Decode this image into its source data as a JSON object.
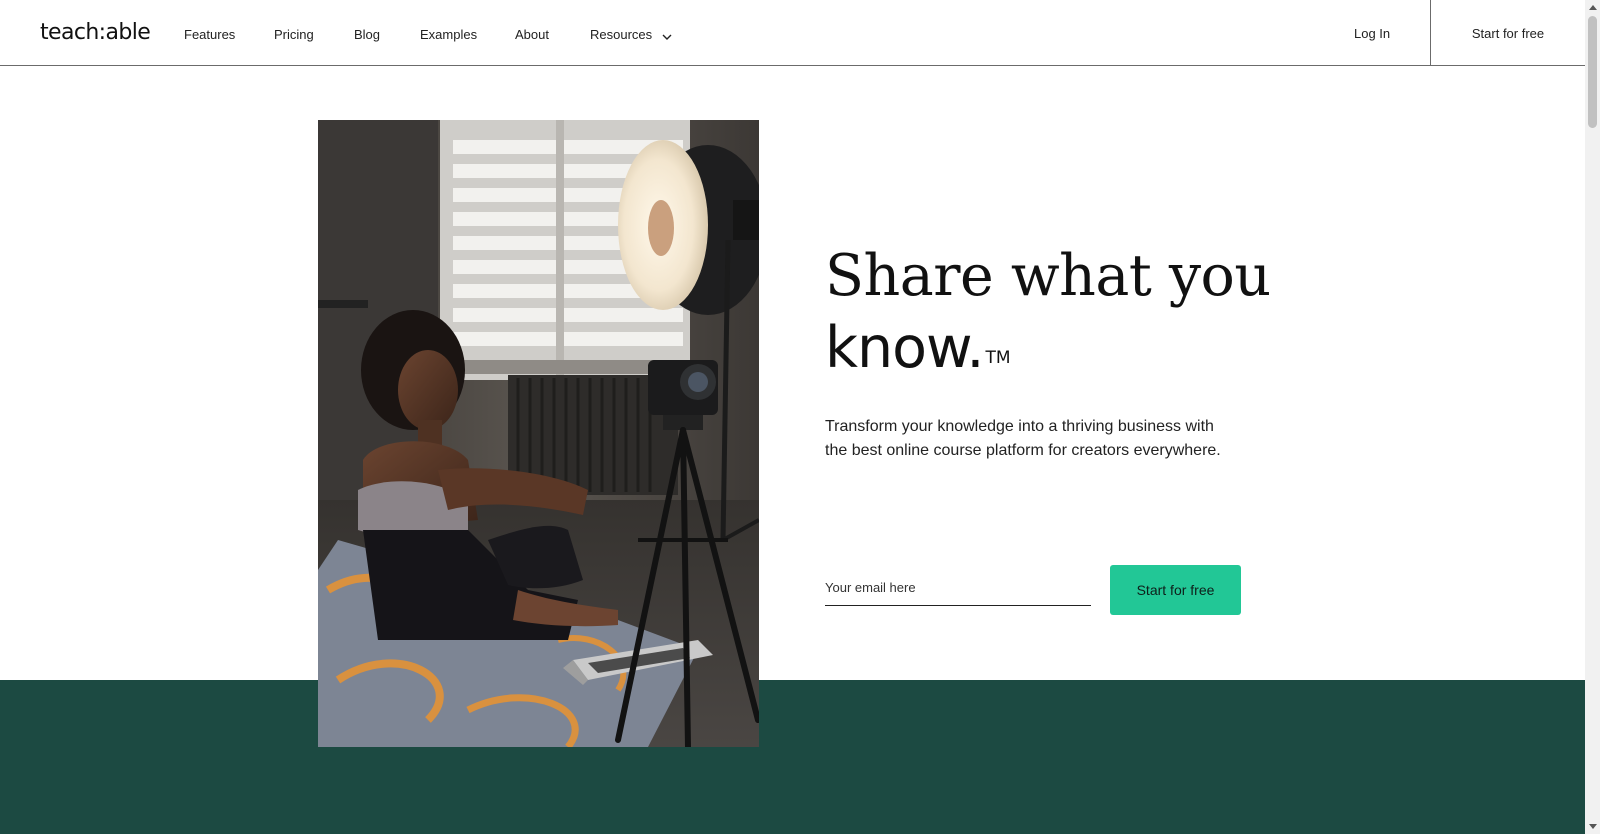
{
  "brand": {
    "logo_text": "teach:able"
  },
  "nav": {
    "items": [
      {
        "label": "Features"
      },
      {
        "label": "Pricing"
      },
      {
        "label": "Blog"
      },
      {
        "label": "Examples"
      },
      {
        "label": "About"
      },
      {
        "label": "Resources",
        "has_dropdown": true,
        "icon": "chevron-down-icon"
      }
    ],
    "login_label": "Log In",
    "cta_label": "Start for free"
  },
  "hero": {
    "headline_line1": "Share what you",
    "headline_line2": "know.",
    "trademark": "TM",
    "subtext": "Transform your knowledge into a thriving business with the best online course platform for creators everywhere.",
    "email_placeholder": "Your email here",
    "email_value": "",
    "cta_label": "Start for free",
    "image": "creator-filming-with-camera-and-ring-light"
  },
  "colors": {
    "accent": "#22c796",
    "band": "#1c4a42",
    "text": "#111111"
  }
}
